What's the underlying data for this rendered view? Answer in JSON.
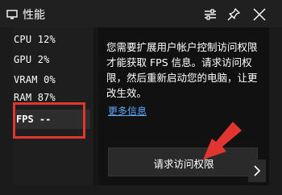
{
  "window": {
    "title": "性能",
    "icons": [
      "monitor-icon",
      "settings-sliders-icon",
      "pin-icon",
      "close-icon"
    ]
  },
  "stats": {
    "cpu": "CPU  12%",
    "gpu": "GPU  2%",
    "vram": "VRAM  0%",
    "ram": "RAM  87%",
    "fps": "FPS --"
  },
  "permission": {
    "message": "您需要扩展用户帐户控制访问权限才能获取 FPS 信息。请求访问权限，然后重新启动您的电脑，让更改生效。",
    "more_info_link": "更多信息",
    "request_button": "请求访问权限",
    "next_icon": "chevron-right-icon"
  },
  "colors": {
    "highlight": "#e1362f",
    "link": "#5ea7ff",
    "background": "#1b1b1b"
  }
}
